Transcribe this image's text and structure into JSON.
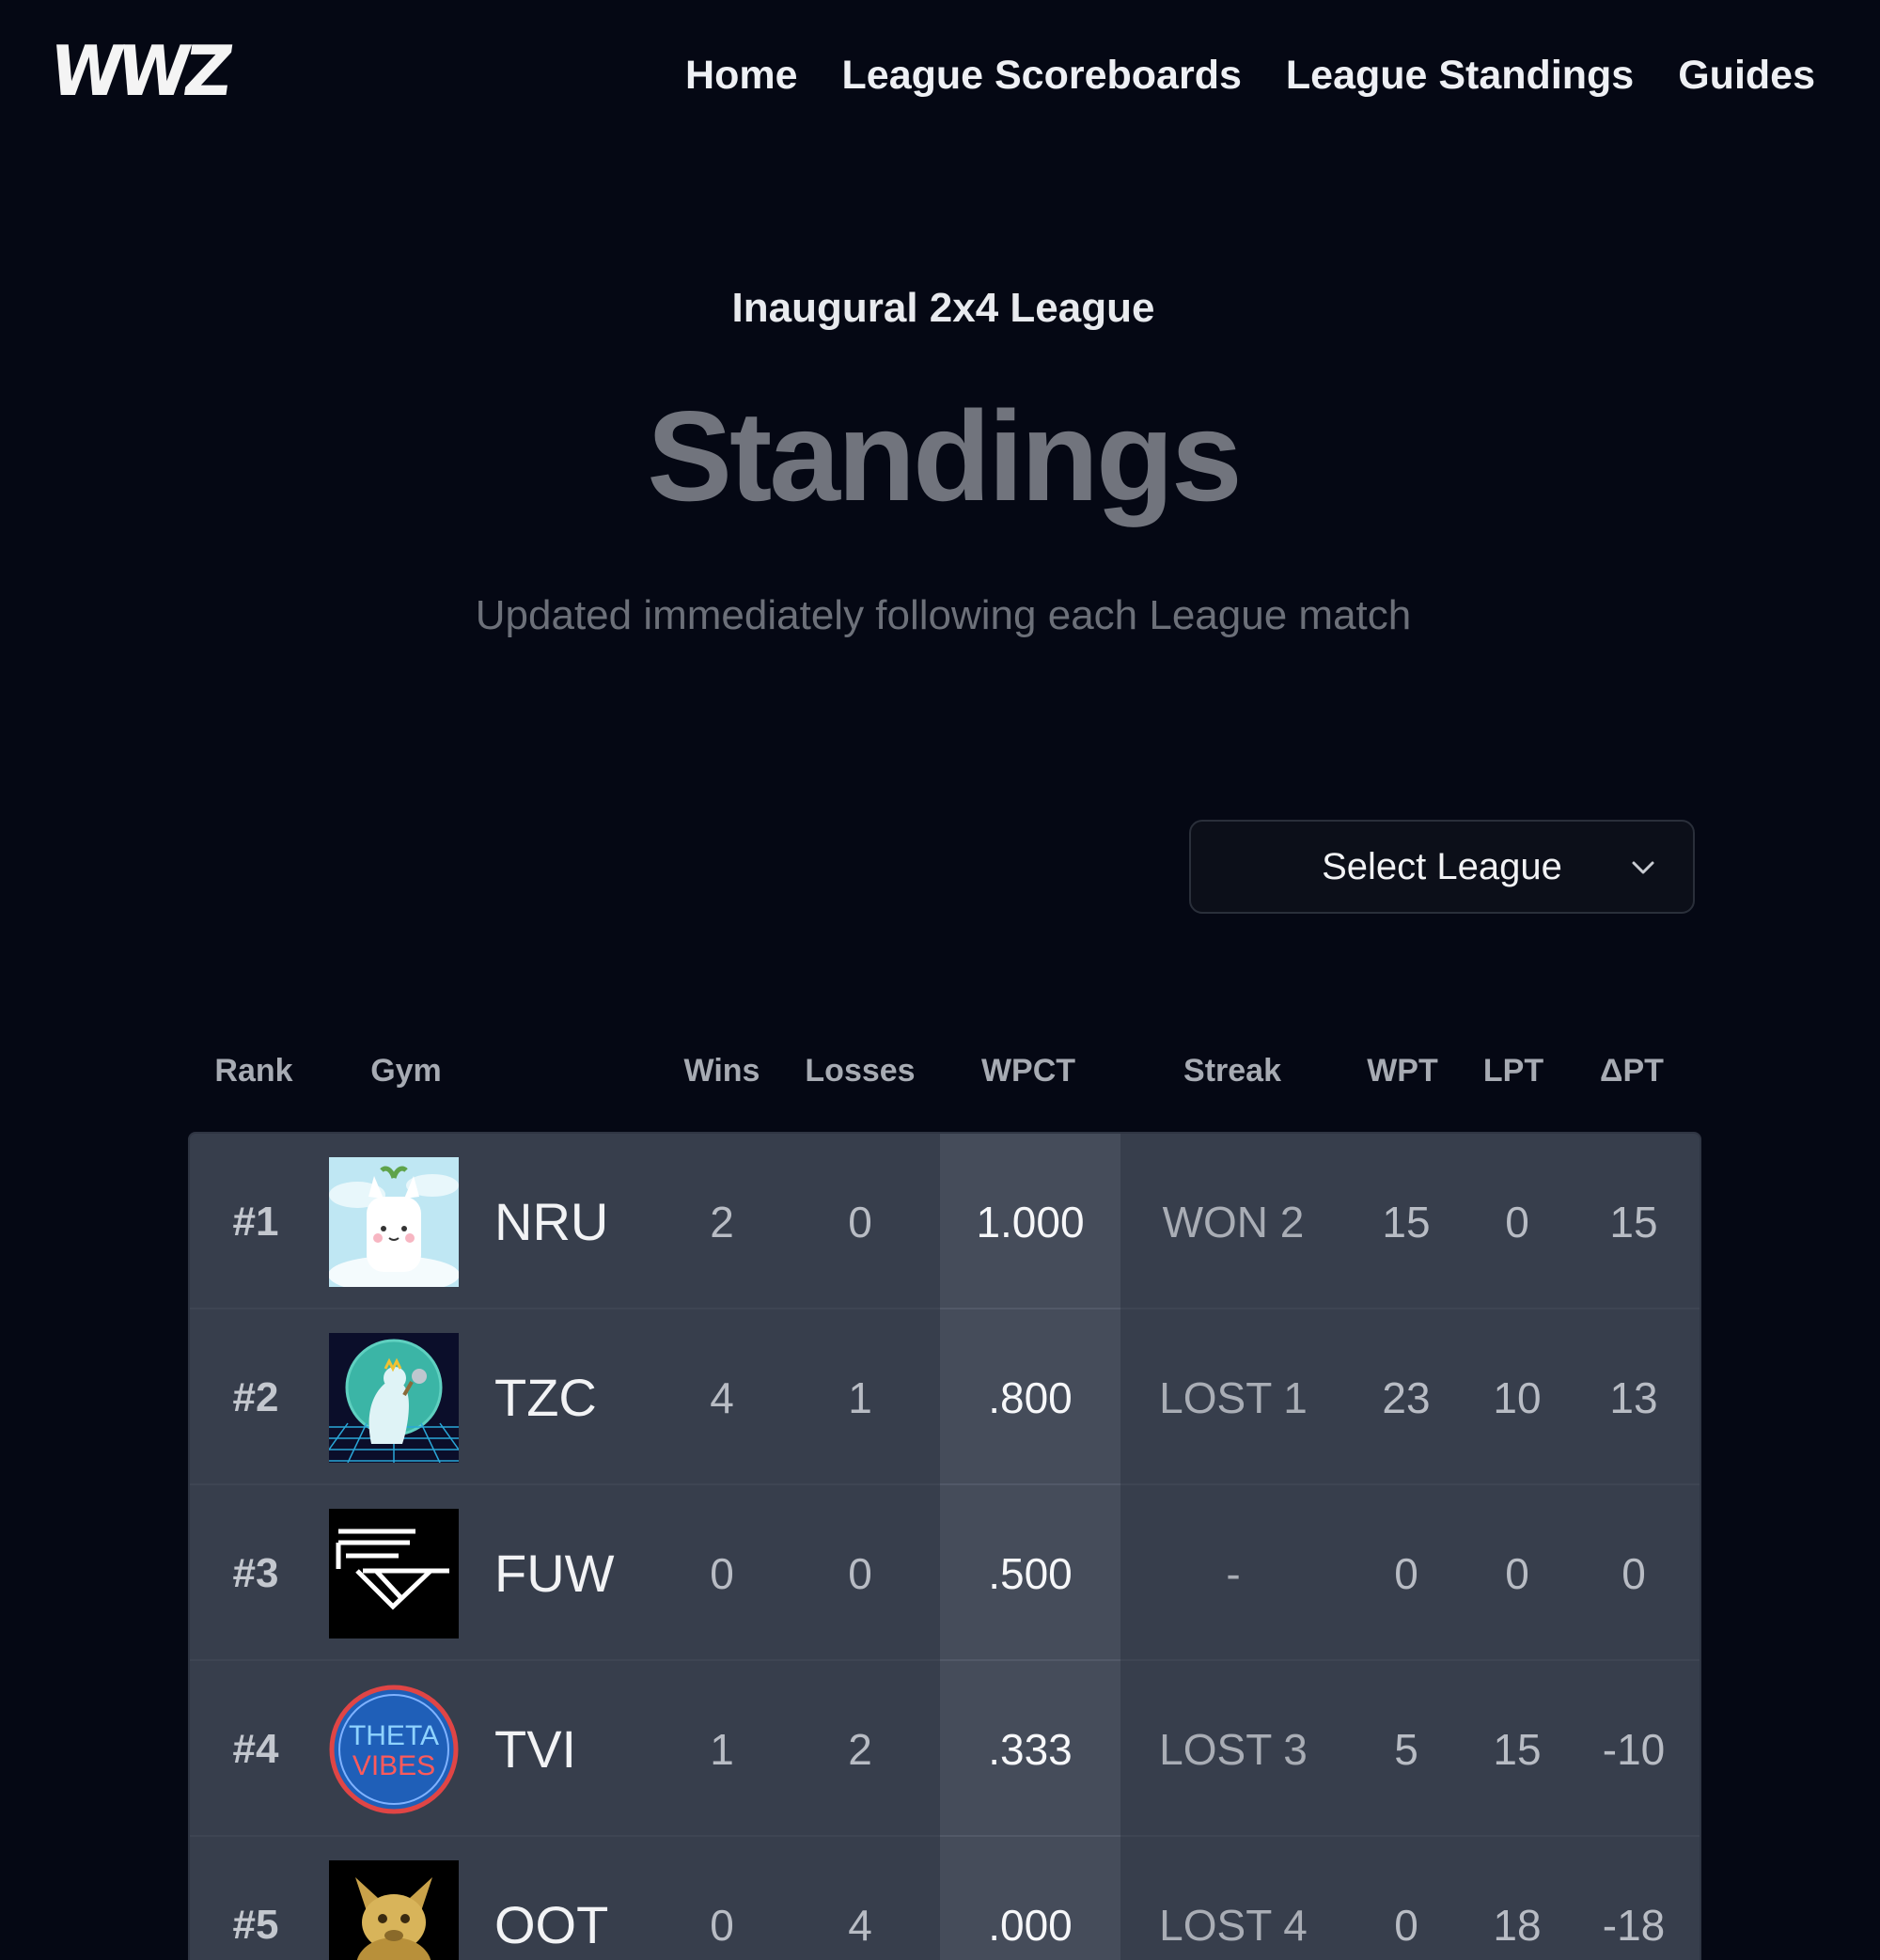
{
  "brand": {
    "logo_text": "WWZ"
  },
  "nav": {
    "items": [
      "Home",
      "League Scoreboards",
      "League Standings",
      "Guides"
    ]
  },
  "hero": {
    "eyebrow": "Inaugural 2x4 League",
    "title": "Standings",
    "subtitle": "Updated immediately following each League match"
  },
  "league_select": {
    "label": "Select League"
  },
  "table": {
    "columns": [
      "Rank",
      "Gym",
      "Wins",
      "Losses",
      "WPCT",
      "Streak",
      "WPT",
      "LPT",
      "ΔPT"
    ],
    "rows": [
      {
        "rank": "#1",
        "gym": "NRU",
        "avatar": "llama-avatar-icon",
        "wins": "2",
        "losses": "0",
        "wpct": "1.000",
        "streak": "WON 2",
        "wpt": "15",
        "lpt": "0",
        "dpt": "15"
      },
      {
        "rank": "#2",
        "gym": "TZC",
        "avatar": "kaiju-avatar-icon",
        "wins": "4",
        "losses": "1",
        "wpct": ".800",
        "streak": "LOST 1",
        "wpt": "23",
        "lpt": "10",
        "dpt": "13"
      },
      {
        "rank": "#3",
        "gym": "FUW",
        "avatar": "fw-logo-avatar-icon",
        "wins": "0",
        "losses": "0",
        "wpct": ".500",
        "streak": "-",
        "wpt": "0",
        "lpt": "0",
        "dpt": "0"
      },
      {
        "rank": "#4",
        "gym": "TVI",
        "avatar": "theta-vibes-avatar-icon",
        "wins": "1",
        "losses": "2",
        "wpct": ".333",
        "streak": "LOST 3",
        "wpt": "5",
        "lpt": "15",
        "dpt": "-10"
      },
      {
        "rank": "#5",
        "gym": "OOT",
        "avatar": "golden-creature-avatar-icon",
        "wins": "0",
        "losses": "4",
        "wpct": ".000",
        "streak": "LOST 4",
        "wpt": "0",
        "lpt": "18",
        "dpt": "-18"
      }
    ]
  },
  "avatar_badges": {
    "theta_vibes_top": "THETA",
    "theta_vibes_bottom": "VIBES"
  },
  "colors": {
    "background": "#050814",
    "table_body": "#373e4c",
    "wpct_band": "#454c5a",
    "title_gray": "#71747d"
  }
}
